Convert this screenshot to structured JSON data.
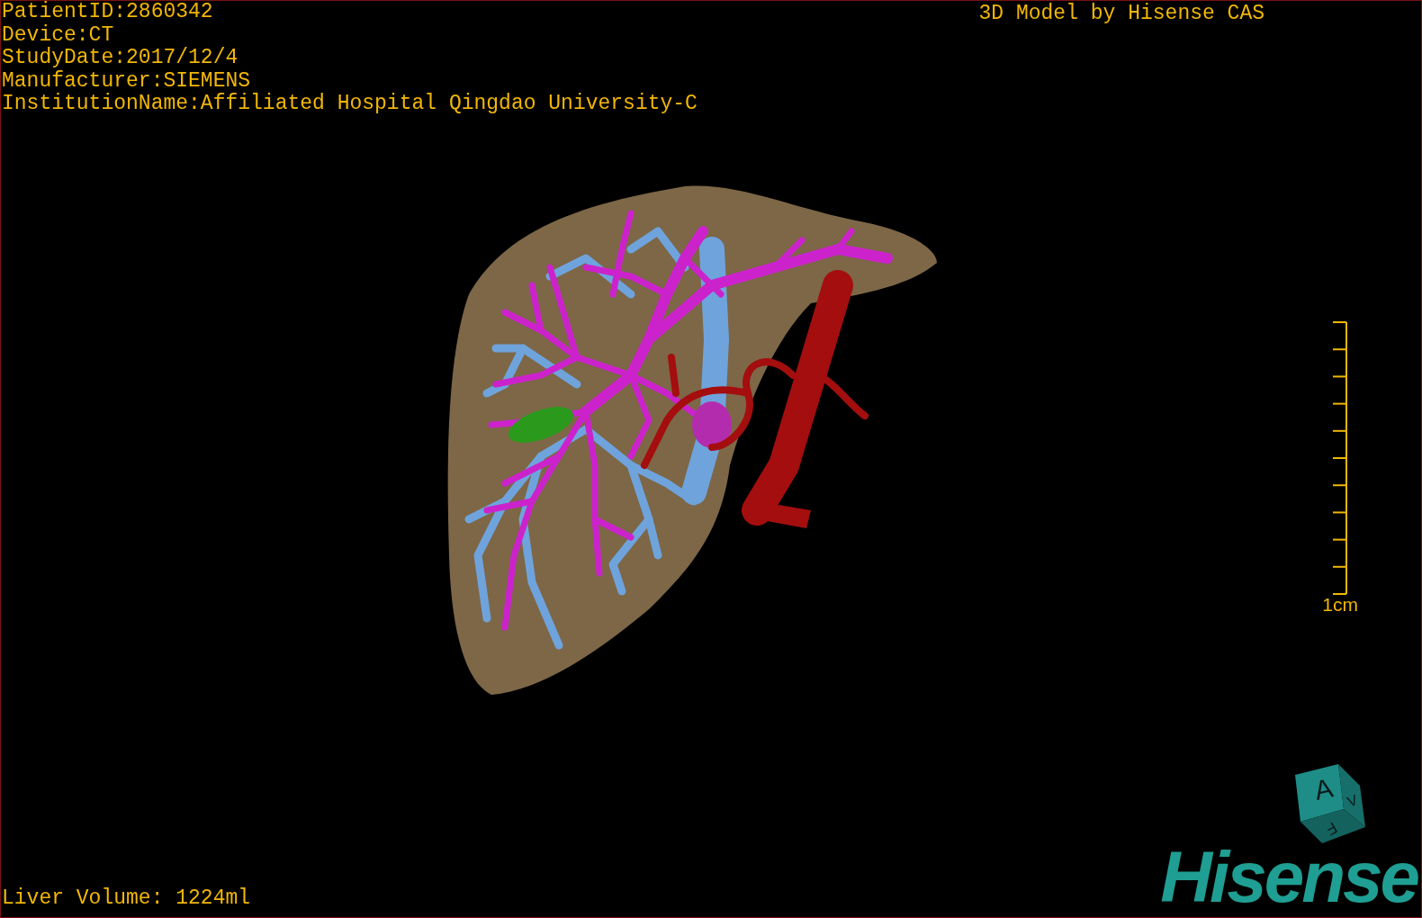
{
  "study_info": [
    "PatientID:2860342",
    "Device:CT",
    "StudyDate:2017/12/4",
    "Manufacturer:SIEMENS",
    "InstitutionName:Affiliated Hospital Qingdao University-C"
  ],
  "title": "3D Model by Hisense CAS",
  "scale_bar": {
    "label": "1cm"
  },
  "liver_volume": "Liver Volume: 1224ml",
  "orientation_cube": {
    "labels": [
      "A",
      "F",
      "V"
    ]
  },
  "logo": "Hisense"
}
